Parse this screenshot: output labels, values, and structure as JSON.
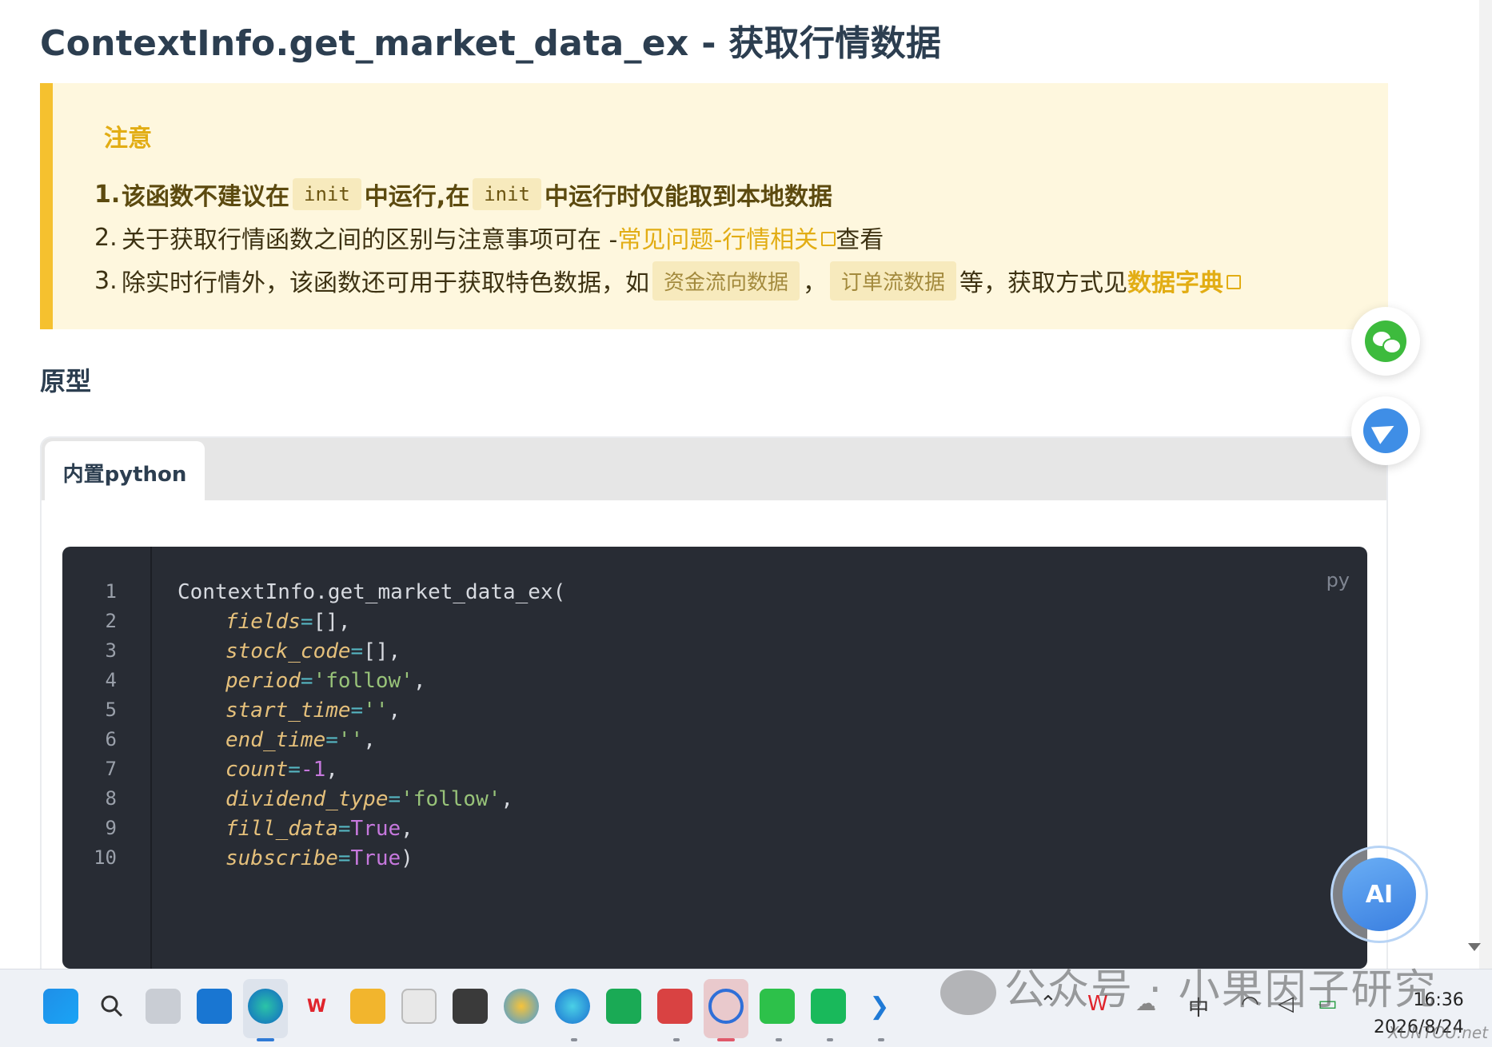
{
  "page": {
    "title": "ContextInfo.get_market_data_ex - 获取行情数据"
  },
  "warning": {
    "title": "注意",
    "item1": {
      "num": "1.",
      "pre": "该函数不建议在",
      "code1": "init",
      "mid": "中运行,在",
      "code2": "init",
      "post": "中运行时仅能取到本地数据"
    },
    "item2": {
      "num": "2.",
      "pre": "关于获取行情函数之间的区别与注意事项可在 - ",
      "link": "常见问题-行情相关",
      "post": " 查看"
    },
    "item3": {
      "num": "3.",
      "pre": "除实时行情外，该函数还可用于获取特色数据，如",
      "tag1": "资金流向数据",
      "sep": "，",
      "tag2": "订单流数据",
      "mid": "等，获取方式见",
      "link": "数据字典"
    }
  },
  "section": {
    "heading": "原型"
  },
  "tabs": {
    "active": "内置python"
  },
  "code": {
    "lang": "py",
    "line_numbers": [
      "1",
      "2",
      "3",
      "4",
      "5",
      "6",
      "7",
      "8",
      "9",
      "10"
    ],
    "line1": "ContextInfo.get_market_data_ex(",
    "params": [
      {
        "name": "fields",
        "eq": "=",
        "val": "[]",
        "val_type": "plain",
        "tail": ","
      },
      {
        "name": "stock_code",
        "eq": "=",
        "val": "[]",
        "val_type": "plain",
        "tail": ","
      },
      {
        "name": "period",
        "eq": "=",
        "val": "'follow'",
        "val_type": "string",
        "tail": ","
      },
      {
        "name": "start_time",
        "eq": "=",
        "val": "''",
        "val_type": "string",
        "tail": ","
      },
      {
        "name": "end_time",
        "eq": "=",
        "val": "''",
        "val_type": "string",
        "tail": ","
      },
      {
        "name": "count",
        "eq": "=",
        "val": "-1",
        "val_type": "number",
        "tail": ","
      },
      {
        "name": "dividend_type",
        "eq": "=",
        "val": "'follow'",
        "val_type": "string",
        "tail": ","
      },
      {
        "name": "fill_data",
        "eq": "=",
        "val": "True",
        "val_type": "keyword",
        "tail": ","
      },
      {
        "name": "subscribe",
        "eq": "=",
        "val": "True",
        "val_type": "keyword",
        "tail": ")"
      }
    ]
  },
  "floating": {
    "ai_label": "AI",
    "icons": [
      "wechat-icon",
      "telegram-icon"
    ]
  },
  "taskbar": {
    "time": "16:36",
    "date": "2026/8/24",
    "ime": "中",
    "icons": [
      "start-icon",
      "search-icon",
      "task-view-icon",
      "outlook-icon",
      "edge-icon",
      "wps-icon",
      "file-explorer-icon",
      "store-icon",
      "terminal-icon",
      "paint-icon",
      "edge-ai-icon",
      "app-green-icon",
      "app-red-icon",
      "app-search-icon",
      "wechat-icon",
      "chat-icon",
      "vscode-icon"
    ]
  },
  "watermark": {
    "text": "公众号 · 小果因子研究",
    "corner": "XUNTOU.net"
  },
  "colors": {
    "accent": "#e2ad14",
    "warning_bg": "#fef7de",
    "warning_border": "#f5c12f",
    "code_bg": "#282c34"
  }
}
